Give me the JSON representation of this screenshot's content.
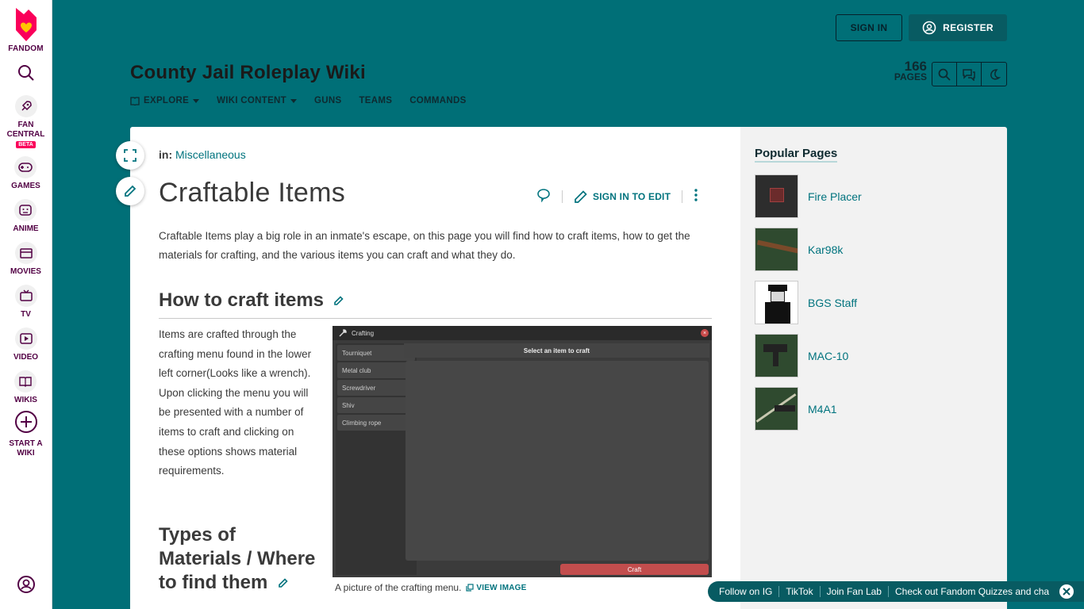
{
  "global_nav": {
    "brand": "FANDOM",
    "items": [
      {
        "label": "FAN\nCENTRAL",
        "badge": "BETA",
        "icon": "rocket-icon"
      },
      {
        "label": "GAMES",
        "icon": "gamepad-icon"
      },
      {
        "label": "ANIME",
        "icon": "anime-icon"
      },
      {
        "label": "MOVIES",
        "icon": "clapperboard-icon"
      },
      {
        "label": "TV",
        "icon": "tv-icon"
      },
      {
        "label": "VIDEO",
        "icon": "play-icon"
      },
      {
        "label": "WIKIS",
        "icon": "book-icon"
      },
      {
        "label": "START A\nWIKI",
        "icon": "plus-circle-icon"
      }
    ]
  },
  "auth": {
    "sign_in": "SIGN IN",
    "register": "REGISTER"
  },
  "wiki": {
    "title": "County Jail Roleplay Wiki",
    "nav": [
      "EXPLORE",
      "WIKI CONTENT",
      "GUNS",
      "TEAMS",
      "COMMANDS"
    ],
    "pages_count": "166",
    "pages_label": "PAGES"
  },
  "article": {
    "breadcrumb_prefix": "in:",
    "breadcrumb_link": "Miscellaneous",
    "title": "Craftable Items",
    "sign_in_to_edit": "SIGN IN TO EDIT",
    "intro": "Craftable Items play a big role in an inmate's escape, on this page you will find how to craft items, how to get the materials for crafting, and the various items you can craft and what they do.",
    "h2_craft": "How to craft items",
    "para_craft": "Items are crafted through the crafting menu found in the lower left corner(Looks like a wrench). Upon clicking the menu you will be presented with a number of items to craft and clicking on these options shows material requirements.",
    "h2_materials": "Types of Materials / Where to find them",
    "image": {
      "window_title": "Crafting",
      "items": [
        "Tourniquet",
        "Metal club",
        "Screwdriver",
        "Shiv",
        "Climbing rope"
      ],
      "select_prompt": "Select an item to craft",
      "craft_button": "Craft",
      "close_glyph": "×"
    },
    "caption": "A picture of the crafting menu.",
    "view_image": "VIEW IMAGE"
  },
  "popular": {
    "title": "Popular Pages",
    "items": [
      "Fire Placer",
      "Kar98k",
      "BGS Staff",
      "MAC-10",
      "M4A1"
    ]
  },
  "follow_bar": [
    "Follow on IG",
    "TikTok",
    "Join Fan Lab",
    "Check out Fandom Quizzes and cha"
  ],
  "colors": {
    "theme": "#006f77",
    "link": "#00737e",
    "fandom_pink": "#fa005a"
  }
}
